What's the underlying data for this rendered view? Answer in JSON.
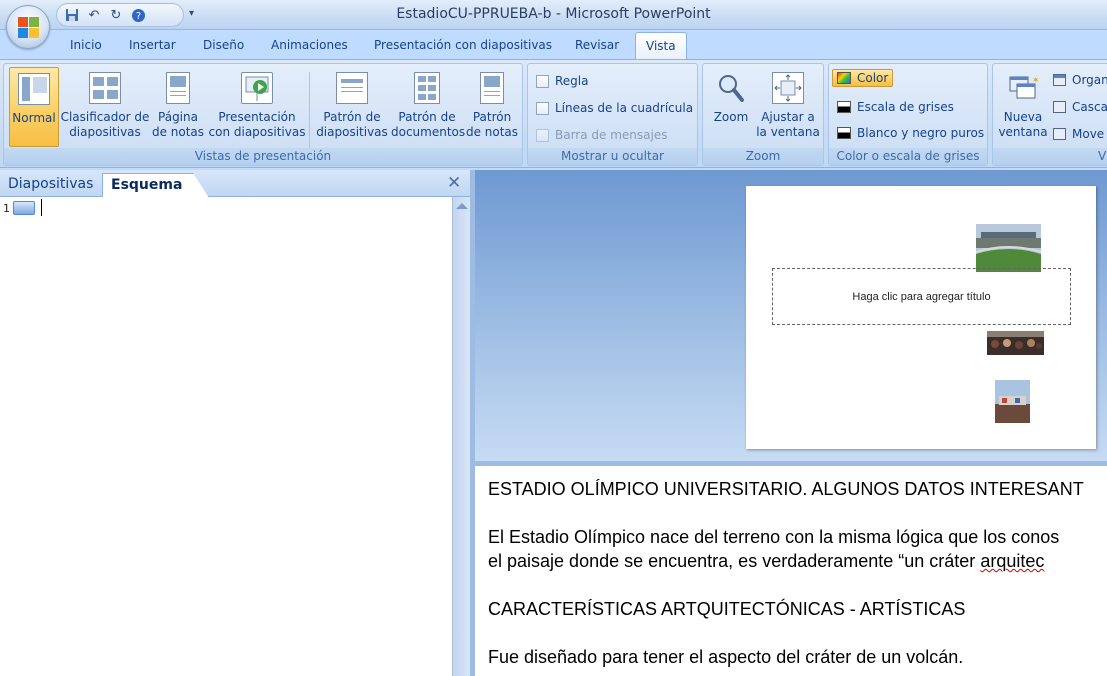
{
  "window": {
    "title": "EstadioCU-PPRUEBA-b - Microsoft PowerPoint"
  },
  "quick_access": {
    "items": [
      {
        "name": "save-icon",
        "glyph": "💾"
      },
      {
        "name": "undo-icon",
        "glyph": "↶"
      },
      {
        "name": "redo-icon",
        "glyph": "↻"
      },
      {
        "name": "help-icon",
        "glyph": "?"
      }
    ]
  },
  "ribbon": {
    "tabs": [
      "Inicio",
      "Insertar",
      "Diseño",
      "Animaciones",
      "Presentación con diapositivas",
      "Revisar",
      "Vista"
    ],
    "active_tab": "Vista",
    "groups": {
      "vistas": {
        "label": "Vistas de presentación",
        "normal": "Normal",
        "clasificador": [
          "Clasificador de",
          "diapositivas"
        ],
        "pagina_notas": [
          "Página",
          "de notas"
        ],
        "presentacion": [
          "Presentación",
          "con diapositivas"
        ],
        "patron_diap": [
          "Patrón de",
          "diapositivas"
        ],
        "patron_doc": [
          "Patrón de",
          "documentos"
        ],
        "patron_notas": [
          "Patrón",
          "de notas"
        ]
      },
      "mostrar": {
        "label": "Mostrar u ocultar",
        "regla": "Regla",
        "lineas": "Líneas de la cuadrícula",
        "barra": "Barra de mensajes"
      },
      "zoom": {
        "label": "Zoom",
        "zoom": "Zoom",
        "ajustar": [
          "Ajustar a",
          "la ventana"
        ]
      },
      "color": {
        "label": "Color o escala de grises",
        "color": "Color",
        "grises": "Escala de grises",
        "blanco_negro": "Blanco y negro puros"
      },
      "ventana": {
        "label": "V",
        "nueva": [
          "Nueva",
          "ventana"
        ],
        "organizar": "Organ",
        "cascada": "Casca",
        "mover": "Move"
      }
    }
  },
  "left_pane": {
    "tabs": [
      "Diapositivas",
      "Esquema"
    ],
    "active_tab": "Esquema",
    "slide_number": "1"
  },
  "slide": {
    "title_placeholder": "Haga clic para agregar título"
  },
  "notes": {
    "lines": [
      "ESTADIO OLÍMPICO UNIVERSITARIO.  ALGUNOS DATOS INTERESANT",
      "El Estadio Olímpico nace del terreno con la misma lógica que los conos",
      "el paisaje donde se encuentra,  es verdaderamente “un cráter ",
      "arquitec",
      "CARACTERÍSTICAS ARTQUITECTÓNICAS - ARTÍSTICAS",
      "Fue diseñado para tener el aspecto del cráter de un volcán."
    ]
  }
}
